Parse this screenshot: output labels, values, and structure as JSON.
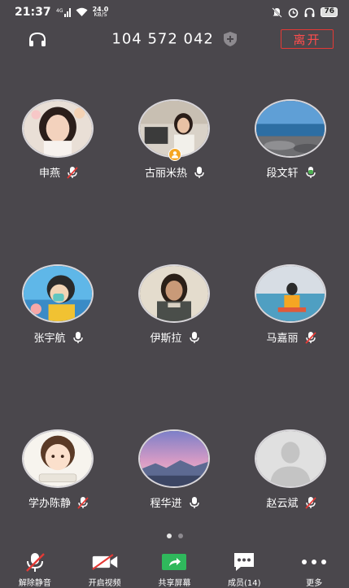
{
  "status_bar": {
    "time": "21:37",
    "net_speed_value": "24.0",
    "net_speed_unit": "KB/S",
    "battery": "76"
  },
  "header": {
    "meeting_id": "104 572 042",
    "leave_label": "离开"
  },
  "participants": [
    {
      "name": "申燕",
      "mic": "muted"
    },
    {
      "name": "古丽米热",
      "mic": "on"
    },
    {
      "name": "段文轩",
      "mic": "speaking"
    },
    {
      "name": "张宇航",
      "mic": "on"
    },
    {
      "name": "伊斯拉",
      "mic": "on"
    },
    {
      "name": "马嘉丽",
      "mic": "muted"
    },
    {
      "name": "学办陈静",
      "mic": "muted"
    },
    {
      "name": "程华进",
      "mic": "on"
    },
    {
      "name": "赵云斌",
      "mic": "muted"
    }
  ],
  "pagination": {
    "pages": 2,
    "current": 1
  },
  "toolbar": {
    "unmute_label": "解除静音",
    "video_label": "开启视频",
    "share_label": "共享屏幕",
    "members_label": "成员(14)",
    "more_label": "更多"
  },
  "colors": {
    "background": "#4a474c",
    "leave_red": "#e53935",
    "muted_red": "#e53935",
    "speaking_green": "#4caf50",
    "share_green": "#2fb85c",
    "host_badge": "#f5a623"
  },
  "icons": {
    "header_left": "headphone-icon",
    "meeting_id_badge": "shield-plus-icon",
    "toolbar": [
      "mic-off-icon",
      "video-off-icon",
      "share-screen-icon",
      "members-icon",
      "more-icon"
    ]
  }
}
